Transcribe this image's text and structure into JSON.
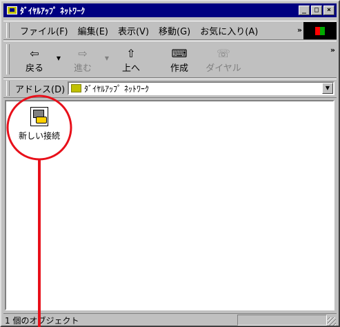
{
  "window": {
    "title": "ﾀﾞｲﾔﾙｱｯﾌﾟ ﾈｯﾄﾜｰｸ",
    "buttons": [
      "_",
      "□",
      "×"
    ]
  },
  "menubar": {
    "items": [
      "ファイル(F)",
      "編集(E)",
      "表示(V)",
      "移動(G)",
      "お気に入り(A)"
    ],
    "chevron": "»"
  },
  "toolbar": {
    "back": {
      "icon": "⇦",
      "label": "戻る"
    },
    "forward": {
      "icon": "⇨",
      "label": "進む"
    },
    "up": {
      "icon": "⇧",
      "label": "上へ"
    },
    "create": {
      "icon": "⌨",
      "label": "作成"
    },
    "dial": {
      "icon": "☏",
      "label": "ダイヤル"
    },
    "chevron": "»"
  },
  "addressbar": {
    "label": "アドレス(D)",
    "value": "ﾀﾞｲﾔﾙｱｯﾌﾟ ﾈｯﾄﾜｰｸ"
  },
  "content": {
    "items": [
      {
        "label": "新しい接続"
      }
    ]
  },
  "statusbar": {
    "text": "1 個のオブジェクト"
  },
  "annotation": {
    "color": "#e8101a"
  }
}
